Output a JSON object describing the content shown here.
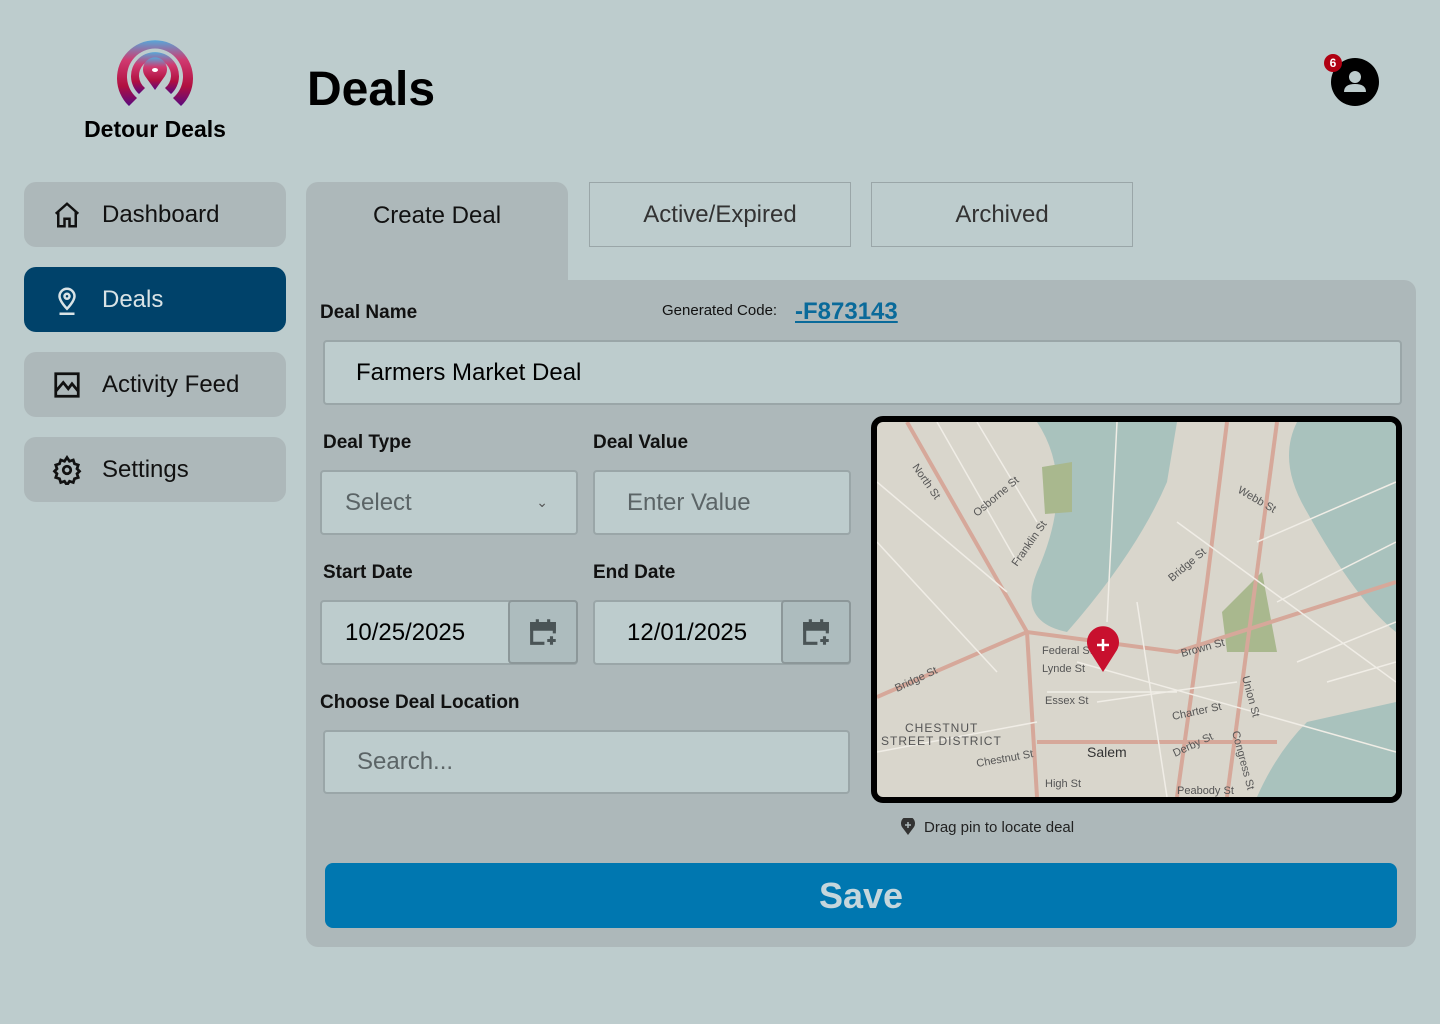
{
  "brand": {
    "name": "Detour Deals"
  },
  "header": {
    "title": "Deals",
    "notification_count": "6"
  },
  "sidebar": {
    "items": [
      {
        "label": "Dashboard",
        "icon": "home-icon"
      },
      {
        "label": "Deals",
        "icon": "location-pin-icon",
        "active": true
      },
      {
        "label": "Activity Feed",
        "icon": "chart-icon"
      },
      {
        "label": "Settings",
        "icon": "gear-icon"
      }
    ]
  },
  "tabs": [
    {
      "label": "Create Deal",
      "active": true
    },
    {
      "label": "Active/Expired"
    },
    {
      "label": "Archived"
    }
  ],
  "form": {
    "deal_name_label": "Deal Name",
    "generated_code_label": "Generated Code:",
    "generated_code": "-F873143",
    "deal_name_value": "Farmers Market Deal",
    "deal_type_label": "Deal Type",
    "deal_type_placeholder": "Select",
    "deal_value_label": "Deal Value",
    "deal_value_placeholder": "Enter Value",
    "start_date_label": "Start Date",
    "start_date": "10/25/2025",
    "end_date_label": "End Date",
    "end_date": "12/01/2025",
    "location_label": "Choose Deal Location",
    "location_placeholder": "Search...",
    "map_hint": "Drag pin to locate deal",
    "save_label": "Save"
  },
  "map": {
    "labels": [
      "Bridge St",
      "Federal St",
      "Lynde St",
      "Essex St",
      "CHESTNUT",
      "STREET DISTRICT",
      "Salem",
      "Chestnut St",
      "High St",
      "Derby St",
      "Charter St",
      "Webb St",
      "Bridge St",
      "Brown St",
      "Congress St",
      "Union St",
      "Peabody St",
      "Franklin St",
      "Osborne St",
      "North St"
    ]
  },
  "colors": {
    "accent": "#0077b0",
    "nav_active": "#00426a",
    "badge": "#b00012",
    "pin": "#c8102e"
  }
}
